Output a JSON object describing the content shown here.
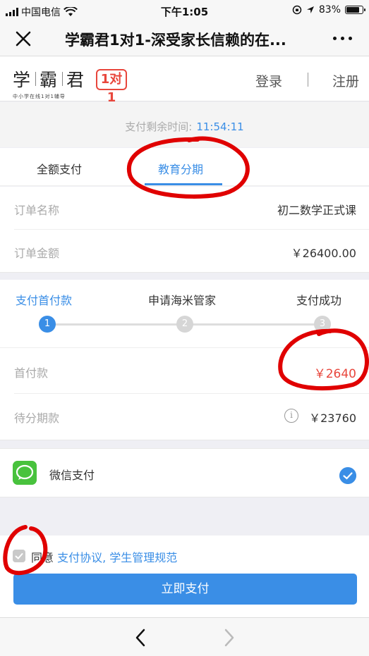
{
  "status_bar": {
    "carrier": "中国电信",
    "time": "下午1:05",
    "battery_percent": "83%",
    "battery_level": 0.83
  },
  "nav": {
    "title": "学霸君1对1-深受家长信赖的在..."
  },
  "site_header": {
    "logo_text": [
      "学",
      "霸",
      "君"
    ],
    "logo_subtitle": "中小学在线1对1辅导",
    "logo_badge": "1对1",
    "login": "登录",
    "separator": "|",
    "register": "注册"
  },
  "countdown": {
    "label": "支付剩余时间:",
    "time": "11:54:11"
  },
  "tabs": {
    "full_payment": "全额支付",
    "installment": "教育分期"
  },
  "order": {
    "name_label": "订单名称",
    "name_value": "初二数学正式课",
    "amount_label": "订单金额",
    "amount_value": "￥26400.00"
  },
  "steps": [
    {
      "label": "支付首付款",
      "number": "1",
      "active": true
    },
    {
      "label": "申请海米管家",
      "number": "2",
      "active": false
    },
    {
      "label": "支付成功",
      "number": "3",
      "active": false
    }
  ],
  "payment_split": {
    "down_payment_label": "首付款",
    "down_payment_value": "￥2640",
    "installment_label": "待分期款",
    "info_icon": "i",
    "installment_value": "￥23760"
  },
  "payment_method": {
    "label": "微信支付"
  },
  "agreement": {
    "prefix": "同意",
    "links": "支付协议, 学生管理规范"
  },
  "pay_button": "立即支付",
  "colors": {
    "accent_blue": "#3a8ee6",
    "price_red": "#e8463c",
    "wechat_green": "#48c23d",
    "annotation_red": "#e00000"
  }
}
